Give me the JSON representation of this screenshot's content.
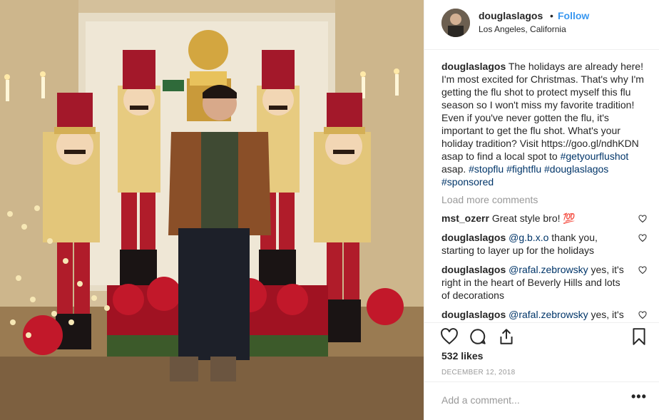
{
  "post": {
    "username": "douglaslagos",
    "dot": "•",
    "follow_label": "Follow",
    "location": "Los Angeles, California",
    "caption_user": "douglaslagos",
    "caption_text": "The holidays are already here! I'm most excited for Christmas. That's why I'm getting the flu shot to protect myself this flu season so I won't miss my favorite tradition! Even if you've never gotten the flu, it's important to get the flu shot. What's your holiday tradition? Visit https://goo.gl/ndhKDN asap to find a local spot to ",
    "caption_tags": [
      "#getyourflushot",
      "asap.",
      "#stopflu",
      "#fightflu",
      "#douglaslagos",
      "#sponsored"
    ],
    "load_more": "Load more comments",
    "comments": [
      {
        "user": "mst_ozerr",
        "mention": "",
        "text": "Great style bro! 💯"
      },
      {
        "user": "douglaslagos",
        "mention": "@g.b.x.o",
        "text": " thank you, starting to layer up for the holidays"
      },
      {
        "user": "douglaslagos",
        "mention": "@rafal.zebrowsky",
        "text": " yes, it's right in the heart of Beverly Hills and lots of decorations"
      },
      {
        "user": "douglaslagos",
        "mention": "@rafal.zebrowsky",
        "text": " yes, it's right in the heart of Beverly Hills and lots of decorations"
      }
    ],
    "likes": "532 likes",
    "date": "DECEMBER 12, 2018",
    "add_comment_placeholder": "Add a comment...",
    "more_label": "•••"
  },
  "icons": {
    "like": "heart-icon",
    "comment": "comment-icon",
    "share": "share-icon",
    "save": "bookmark-icon",
    "comment_like": "heart-icon"
  }
}
